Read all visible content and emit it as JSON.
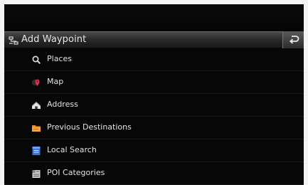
{
  "header": {
    "title": "Add Waypoint",
    "icon": "route-icon",
    "back_icon": "back-arrow-icon"
  },
  "menu": {
    "items": [
      {
        "label": "Places",
        "icon": "magnifier-icon"
      },
      {
        "label": "Map",
        "icon": "map-pin-icon"
      },
      {
        "label": "Address",
        "icon": "house-icon"
      },
      {
        "label": "Previous Destinations",
        "icon": "folder-icon"
      },
      {
        "label": "Local Search",
        "icon": "search-book-icon"
      },
      {
        "label": "POI Categories",
        "icon": "poi-list-icon"
      }
    ]
  },
  "colors": {
    "background": "#050505",
    "header_top": "#4a4a4a",
    "header_bottom": "#181818",
    "text": "#e6e6e6",
    "map_icon": "#d9324a",
    "folder_icon": "#f08a24",
    "local_search_icon": "#3a73d8"
  }
}
